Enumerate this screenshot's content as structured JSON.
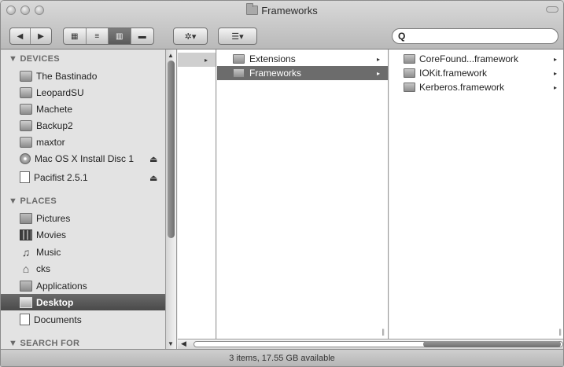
{
  "window": {
    "title": "Frameworks"
  },
  "toolbar": {
    "back_glyph": "◀",
    "forward_glyph": "▶",
    "view_icon_glyph": "▦",
    "view_list_glyph": "≡",
    "view_column_glyph": "▥",
    "view_coverflow_glyph": "▬",
    "action_glyph": "✲▾",
    "arrange_glyph": "☰▾",
    "active_view": "column"
  },
  "search": {
    "glyph": "Q",
    "placeholder": ""
  },
  "sidebar": {
    "devices_header": "▼ DEVICES",
    "devices": [
      {
        "label": "The Bastinado",
        "icon": "hard-drive-icon"
      },
      {
        "label": "LeopardSU",
        "icon": "external-drive-icon"
      },
      {
        "label": "Machete",
        "icon": "hard-drive-icon"
      },
      {
        "label": "Backup2",
        "icon": "hard-drive-icon"
      },
      {
        "label": "maxtor",
        "icon": "hard-drive-icon"
      },
      {
        "label": "Mac OS X Install Disc 1",
        "icon": "disc-icon",
        "eject": "⏏"
      },
      {
        "label": "Pacifist 2.5.1",
        "icon": "document-icon",
        "eject": "⏏"
      }
    ],
    "places_header": "▼ PLACES",
    "places": [
      {
        "label": "Pictures",
        "icon": "pictures-folder-icon"
      },
      {
        "label": "Movies",
        "icon": "movies-icon"
      },
      {
        "label": "Music",
        "icon": "music-icon",
        "glyph": "♫"
      },
      {
        "label": "cks",
        "icon": "home-icon",
        "glyph": "⌂"
      },
      {
        "label": "Applications",
        "icon": "applications-folder-icon"
      },
      {
        "label": "Desktop",
        "icon": "desktop-icon",
        "selected": true
      },
      {
        "label": "Documents",
        "icon": "documents-icon"
      }
    ],
    "search_header": "▼ SEARCH FOR"
  },
  "columns": {
    "col0": {
      "chevron": "▸"
    },
    "col1": [
      {
        "label": "Extensions",
        "chevron": "▸"
      },
      {
        "label": "Frameworks",
        "chevron": "▸",
        "selected": true
      }
    ],
    "col2": [
      {
        "label": "CoreFound...framework",
        "chevron": "▸"
      },
      {
        "label": "IOKit.framework",
        "chevron": "▸"
      },
      {
        "label": "Kerberos.framework",
        "chevron": "▸"
      }
    ],
    "resize_glyph": "||"
  },
  "scroll": {
    "up": "▲",
    "down": "▼",
    "left": "◀"
  },
  "status": {
    "text": "3 items, 17.55 GB available"
  }
}
